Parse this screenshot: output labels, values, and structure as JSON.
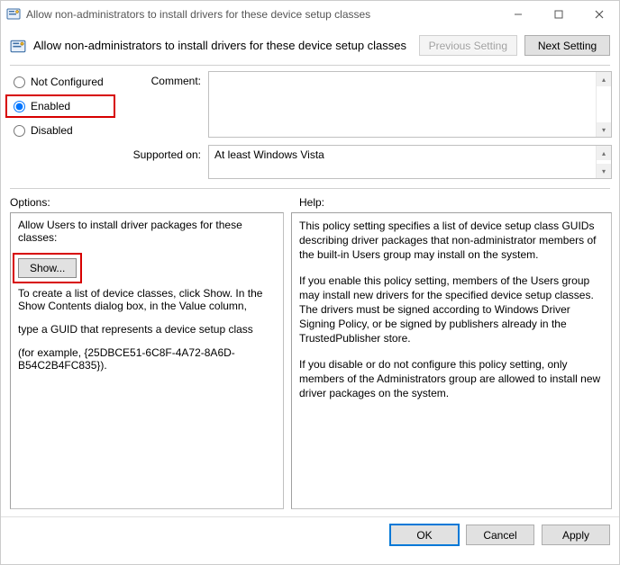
{
  "window": {
    "title": "Allow non-administrators to install drivers for these device setup classes"
  },
  "header": {
    "policy_name": "Allow non-administrators to install drivers for these device setup classes",
    "prev_label": "Previous Setting",
    "next_label": "Next Setting"
  },
  "state": {
    "notconf_label": "Not Configured",
    "enabled_label": "Enabled",
    "disabled_label": "Disabled",
    "selected": "enabled"
  },
  "fields": {
    "comment_label": "Comment:",
    "comment_value": "",
    "supported_label": "Supported on:",
    "supported_value": "At least Windows Vista"
  },
  "sections": {
    "options_label": "Options:",
    "help_label": "Help:"
  },
  "options": {
    "intro": "Allow Users to install driver packages for these classes:",
    "show_button": "Show...",
    "instr1": "To create a list of device classes, click Show. In the Show Contents dialog box, in the Value column,",
    "instr2": "type a GUID that represents a device setup class",
    "instr3": "(for example, {25DBCE51-6C8F-4A72-8A6D-B54C2B4FC835})."
  },
  "help": {
    "p1": "This policy setting specifies a list of device setup class GUIDs describing driver packages that non-administrator members of the built-in Users group may install on the system.",
    "p2": "If you enable this policy setting, members of the Users group may install new drivers for the specified device setup classes. The drivers must be signed according to Windows Driver Signing Policy, or be signed by publishers already in the TrustedPublisher store.",
    "p3": "If you disable or do not configure this policy setting, only members of the Administrators group are allowed to install new driver packages on the system."
  },
  "footer": {
    "ok": "OK",
    "cancel": "Cancel",
    "apply": "Apply"
  }
}
